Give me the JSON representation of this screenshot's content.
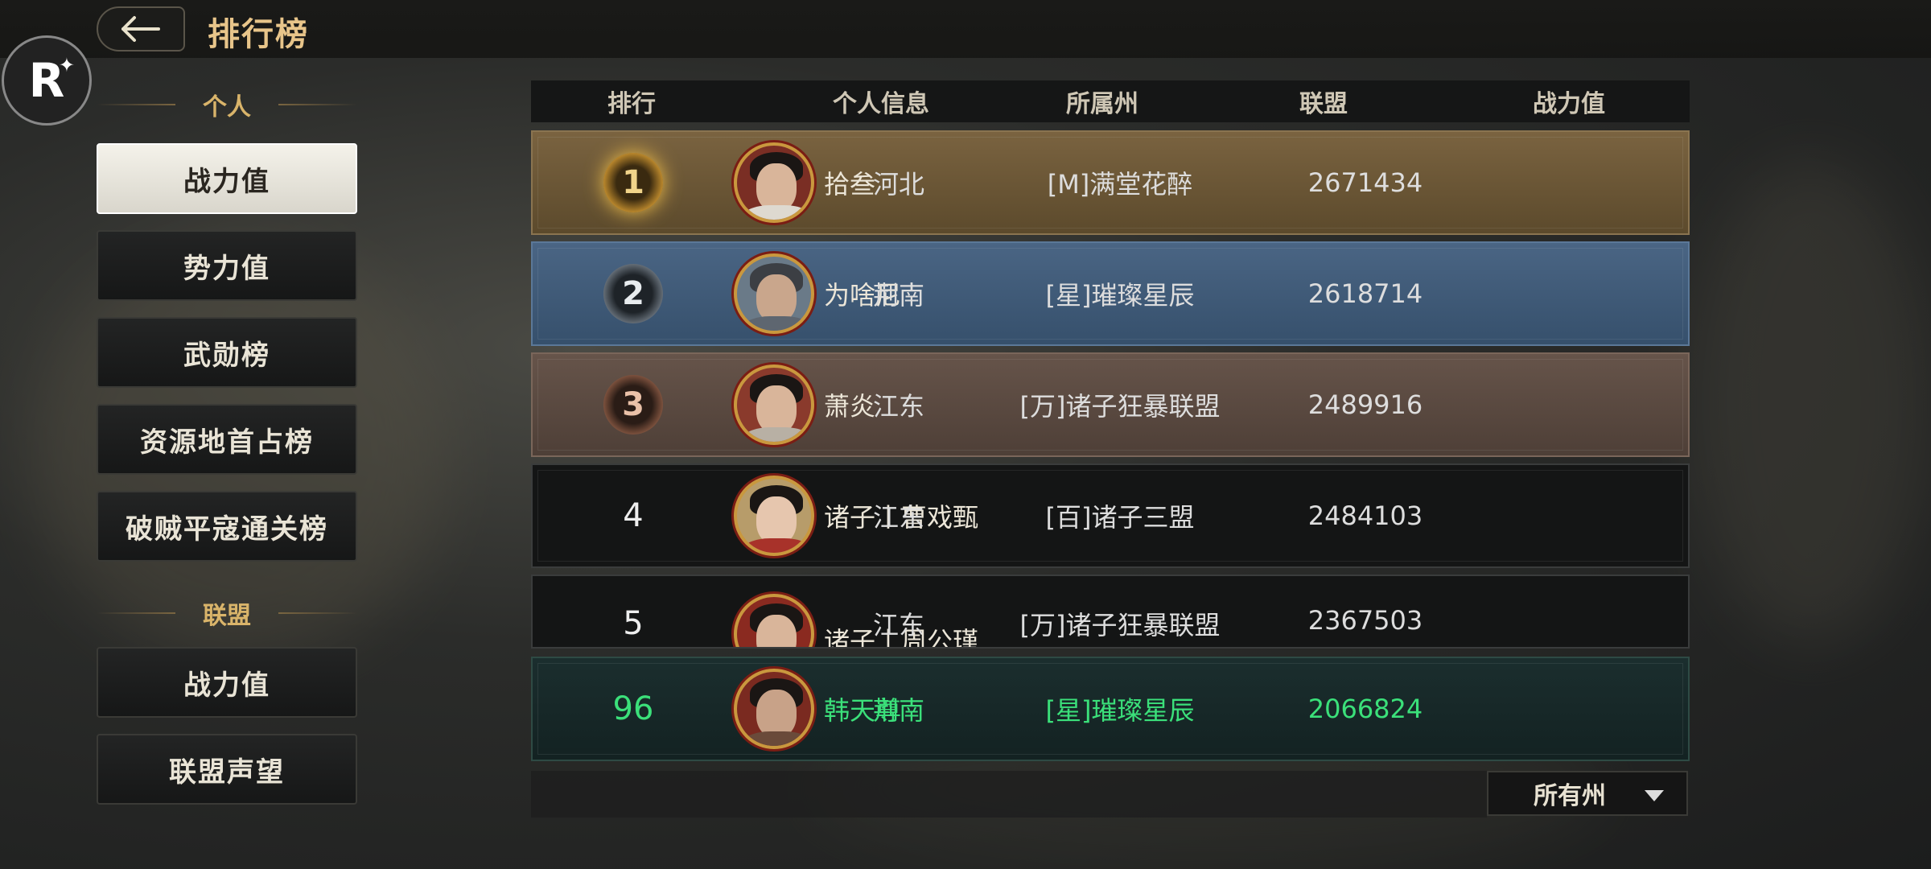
{
  "header": {
    "title": "排行榜",
    "back_icon": "arrow-left-icon"
  },
  "logo": {
    "letter": "R",
    "star": "✦"
  },
  "sidebar": {
    "personal_heading": "个人",
    "personal_items": [
      "战力值",
      "势力值",
      "武勋榜",
      "资源地首占榜",
      "破贼平寇通关榜"
    ],
    "alliance_heading": "联盟",
    "alliance_items": [
      "战力值",
      "联盟声望"
    ]
  },
  "table": {
    "headers": [
      "排行",
      "个人信息",
      "所属州",
      "联盟",
      "战力值"
    ],
    "rows": [
      {
        "rank": "1",
        "name": "拾叁",
        "state": "河北",
        "alliance": "[M]满堂花醉",
        "power": "2671434"
      },
      {
        "rank": "2",
        "name": "为啥尼",
        "state": "荆南",
        "alliance": "[星]璀璨星辰",
        "power": "2618714"
      },
      {
        "rank": "3",
        "name": "萧炎",
        "state": "江东",
        "alliance": "[万]诸子狂暴联盟",
        "power": "2489916"
      },
      {
        "rank": "4",
        "name": "诸子丨曹戏甄",
        "state": "江东",
        "alliance": "[百]诸子三盟",
        "power": "2484103"
      },
      {
        "rank": "5",
        "name": "诸子丨周公瑾",
        "state": "江东",
        "alliance": "[万]诸子狂暴联盟",
        "power": "2367503"
      }
    ],
    "self_row": {
      "rank": "96",
      "name": "韩天尊",
      "state": "荆南",
      "alliance": "[星]璀璨星辰",
      "power": "2066824"
    }
  },
  "filter": {
    "label": "所有州"
  },
  "colors": {
    "gold": "#e8c58a",
    "row1": "#6b5634",
    "row2": "#3d5573",
    "row3": "#5a4a42",
    "row_default": "#151616",
    "self_row": "#17282a",
    "self_text": "#3be07a"
  }
}
